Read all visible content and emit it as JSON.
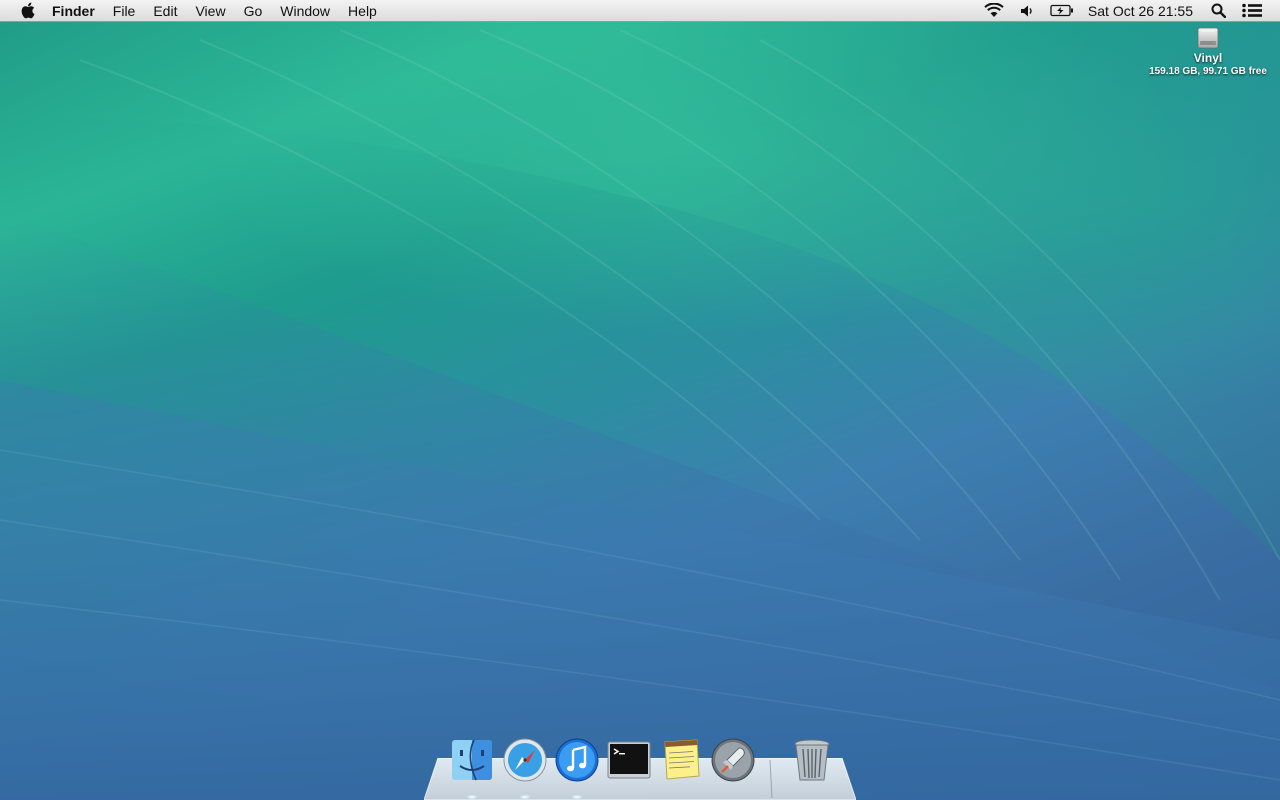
{
  "menubar": {
    "app_name": "Finder",
    "items": [
      "File",
      "Edit",
      "View",
      "Go",
      "Window",
      "Help"
    ],
    "clock": "Sat Oct 26  21:55",
    "status_icons": [
      "wifi-icon",
      "volume-icon",
      "battery-icon",
      "spotlight-icon",
      "notification-center-icon"
    ]
  },
  "desktop": {
    "disk": {
      "name": "Vinyl",
      "info": "159.18 GB, 99.71 GB free"
    }
  },
  "dock": {
    "apps": [
      "finder",
      "safari",
      "itunes",
      "terminal",
      "stickies",
      "launchpad",
      "trash"
    ],
    "running": [
      "finder",
      "safari",
      "itunes"
    ]
  },
  "colors": {
    "menubar_top": "#f3f3f3",
    "menubar_bottom": "#dcdcdc",
    "wave_green": "#2bb596",
    "wave_blue": "#3a6ea3"
  }
}
